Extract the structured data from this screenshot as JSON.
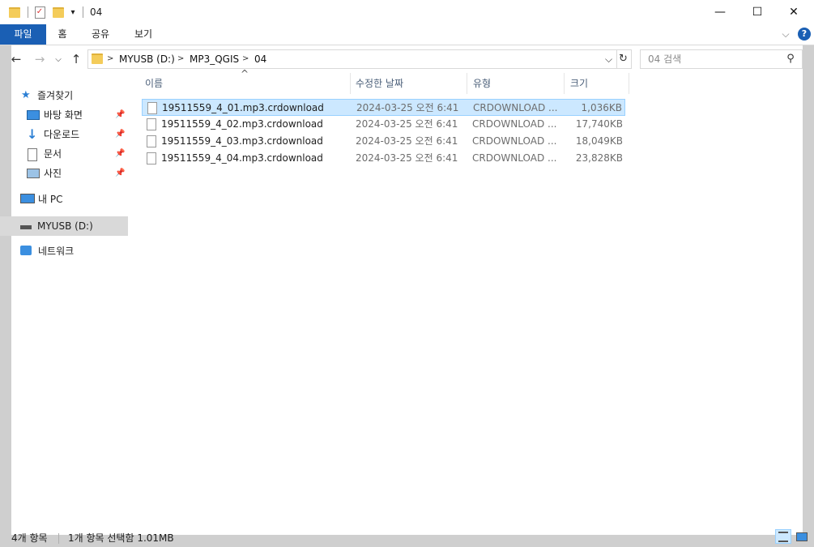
{
  "window": {
    "title": "04",
    "minimize": "—",
    "maximize": "☐",
    "close": "✕"
  },
  "ribbon": {
    "tabs": [
      "파일",
      "홈",
      "공유",
      "보기"
    ],
    "expand_chevron": "⌵",
    "help": "?"
  },
  "address": {
    "path": [
      "MYUSB (D:)",
      "MP3_QGIS",
      "04"
    ],
    "separator": ">",
    "dropdown": "⌵",
    "refresh": "↻"
  },
  "search": {
    "placeholder": "04 검색"
  },
  "sidebar": {
    "quick_access": "즐겨찾기",
    "pinned": [
      "바탕 화면",
      "다운로드",
      "문서",
      "사진"
    ],
    "this_pc": "내 PC",
    "drive": "MYUSB (D:)",
    "network": "네트워크"
  },
  "columns": {
    "name": "이름",
    "modified": "수정한 날짜",
    "type": "유형",
    "size": "크기"
  },
  "files": [
    {
      "name": "19511559_4_01.mp3.crdownload",
      "modified": "2024-03-25 오전 6:41",
      "type": "CRDOWNLOAD ...",
      "size": "1,036KB",
      "selected": true
    },
    {
      "name": "19511559_4_02.mp3.crdownload",
      "modified": "2024-03-25 오전 6:41",
      "type": "CRDOWNLOAD ...",
      "size": "17,740KB",
      "selected": false
    },
    {
      "name": "19511559_4_03.mp3.crdownload",
      "modified": "2024-03-25 오전 6:41",
      "type": "CRDOWNLOAD ...",
      "size": "18,049KB",
      "selected": false
    },
    {
      "name": "19511559_4_04.mp3.crdownload",
      "modified": "2024-03-25 오전 6:41",
      "type": "CRDOWNLOAD ...",
      "size": "23,828KB",
      "selected": false
    }
  ],
  "status": {
    "item_count": "4개 항목",
    "selection": "1개 항목 선택함 1.01MB"
  },
  "colors": {
    "accent": "#1a5fb4",
    "selection_bg": "#cce8ff",
    "frame": "#cfcfcf"
  }
}
